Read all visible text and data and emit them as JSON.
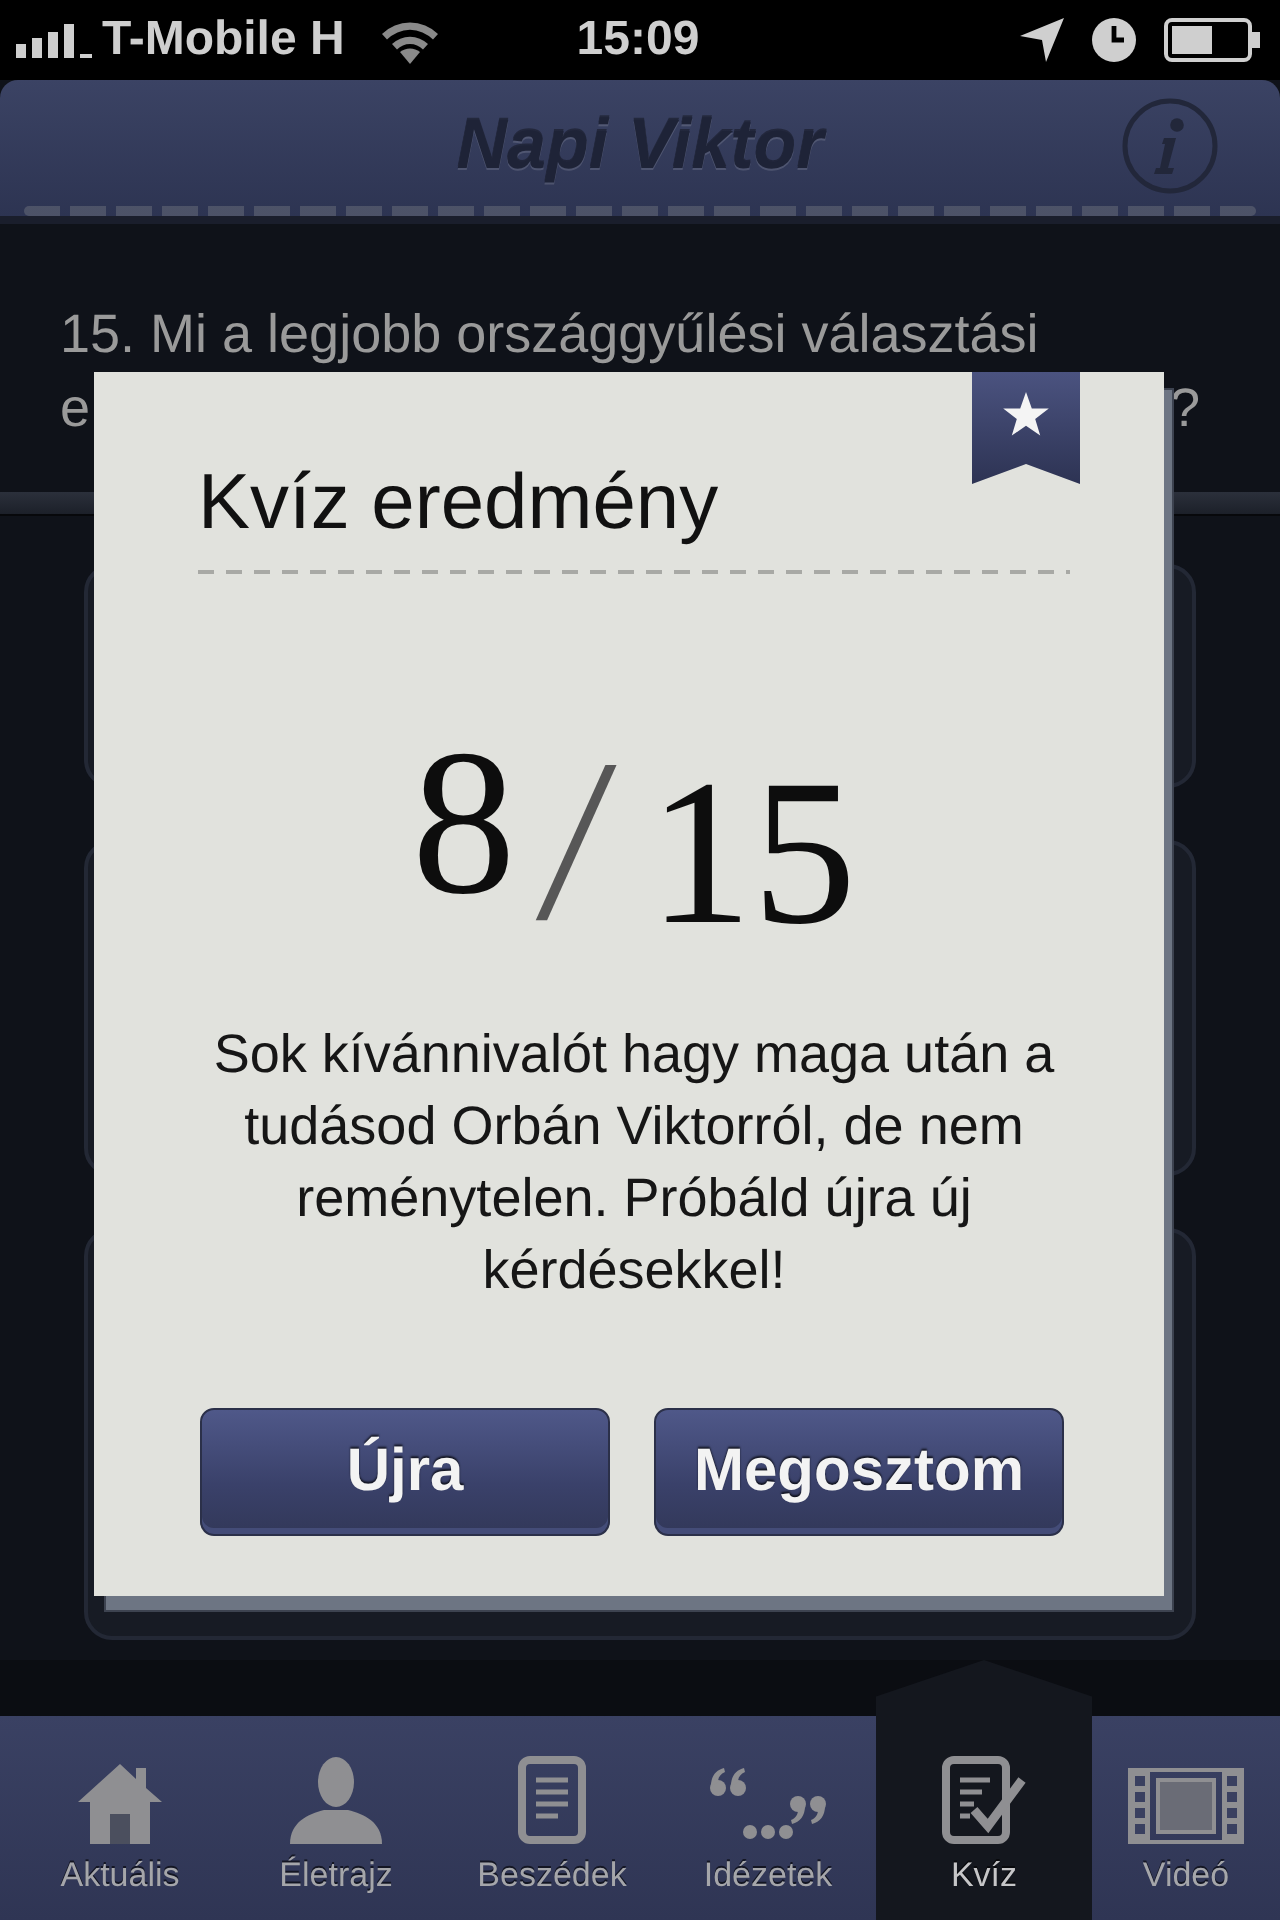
{
  "status_bar": {
    "carrier": "T-Mobile H",
    "time": "15:09"
  },
  "nav_bar": {
    "title": "Napi Viktor"
  },
  "question": {
    "line_1": "15. Mi a legjobb országgyűlési választási",
    "line_2_start": "e",
    "line_2_end": "?"
  },
  "result_dialog": {
    "title": "Kvíz eredmény",
    "score": {
      "correct": "8",
      "separator": "/",
      "total": "15"
    },
    "message": "Sok kívánnivalót hagy maga után a tudásod Orbán Viktorról, de nem reménytelen. Próbáld újra új kérdésekkel!",
    "buttons": [
      "Újra",
      "Megosztom"
    ]
  },
  "tab_bar": {
    "tabs": [
      {
        "label": "Aktuális",
        "selected": false
      },
      {
        "label": "Életrajz",
        "selected": false
      },
      {
        "label": "Beszédek",
        "selected": false
      },
      {
        "label": "Idézetek",
        "selected": false
      },
      {
        "label": "Kvíz",
        "selected": true
      },
      {
        "label": "Videó",
        "selected": false
      }
    ]
  }
}
